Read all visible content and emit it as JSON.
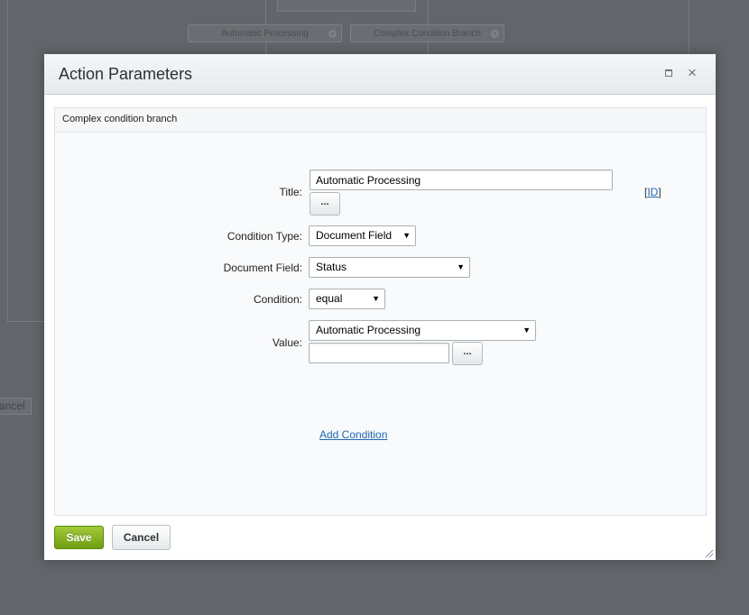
{
  "background": {
    "nodes": [
      {
        "label": "Automatic Processing"
      },
      {
        "label": "Complex Condition Branch"
      }
    ],
    "cancel_label": "ancel"
  },
  "dialog": {
    "title": "Action Parameters",
    "section_title": "Complex condition branch",
    "fields": {
      "title": {
        "label": "Title:",
        "value": "Automatic Processing",
        "browse_label": "..."
      },
      "id_link": {
        "prefix": "[",
        "label": "ID",
        "suffix": "]"
      },
      "condition_type": {
        "label": "Condition Type:",
        "value": "Document Field"
      },
      "document_field": {
        "label": "Document Field:",
        "value": "Status"
      },
      "condition": {
        "label": "Condition:",
        "value": "equal"
      },
      "value": {
        "label": "Value:",
        "selected": "Automatic Processing",
        "text_value": "",
        "browse_label": "..."
      }
    },
    "add_condition_label": "Add Condition",
    "buttons": {
      "save": "Save",
      "cancel": "Cancel"
    }
  }
}
